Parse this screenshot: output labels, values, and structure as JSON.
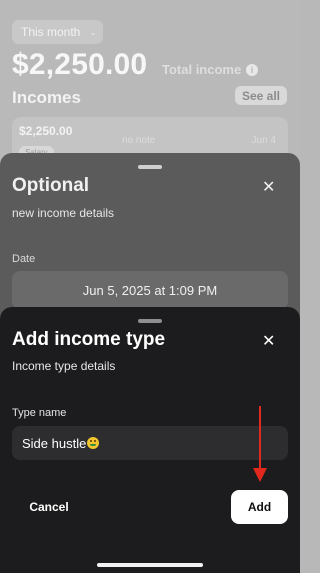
{
  "background": {
    "period_selector": {
      "label": "This month"
    },
    "total": {
      "amount": "$2,250.00",
      "label": "Total income"
    },
    "incomes_heading": "Incomes",
    "see_all_label": "See all",
    "income_item": {
      "amount": "$2,250.00",
      "tag": "Salary",
      "note": "no note",
      "date": "Jun 4"
    }
  },
  "optional_sheet": {
    "title": "Optional",
    "subtitle": "new income details",
    "date_label": "Date",
    "date_value": "Jun 5, 2025 at 1:09 PM"
  },
  "income_type_sheet": {
    "title": "Add income type",
    "subtitle": "Income type details",
    "type_name_label": "Type name",
    "type_name_value": "Side hustle",
    "cancel_label": "Cancel",
    "add_label": "Add"
  },
  "icons": {
    "chevron": "chevron-down-icon",
    "info": "info-icon",
    "close": "close-icon",
    "emoji": "money-mouth-face-emoji",
    "annotation_arrow": "red-arrow-icon"
  },
  "colors": {
    "sheet_background": "#1c1c1e",
    "input_background": "#2d2d30",
    "primary_button": "#ffffff",
    "annotation_arrow": "#e0281f"
  }
}
